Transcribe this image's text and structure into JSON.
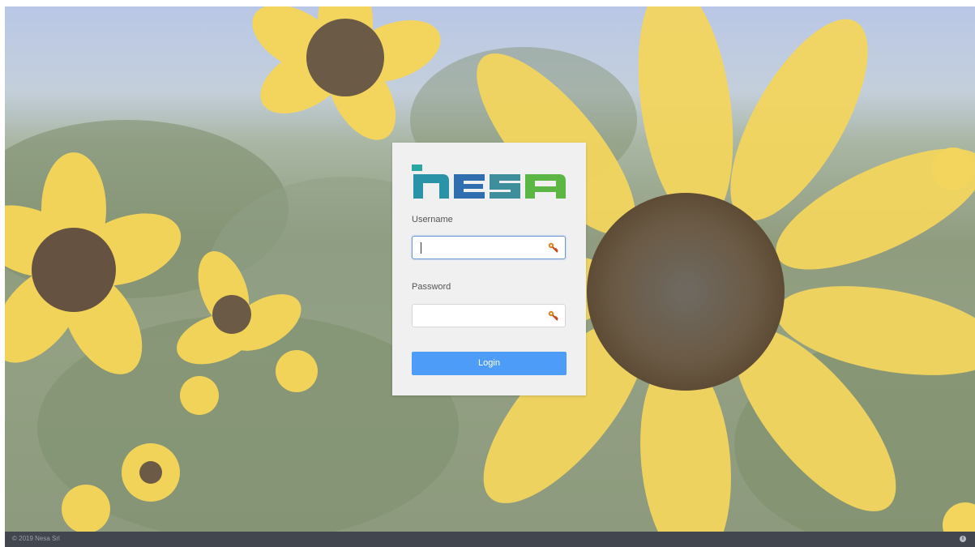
{
  "login": {
    "username_label": "Username",
    "username_value": "",
    "password_label": "Password",
    "password_value": "",
    "login_label": "Login"
  },
  "brand": {
    "logo_text": "nesa",
    "colors": {
      "logo_teal": "#2aa6a3",
      "logo_blue": "#2f6eaf",
      "logo_green": "#5cb644",
      "button": "#4d9cf8"
    }
  },
  "icons": {
    "field_icon": "key-icon",
    "footer_icon": "info-icon"
  },
  "footer": {
    "copyright": "© 2019 Nesa Srl"
  }
}
